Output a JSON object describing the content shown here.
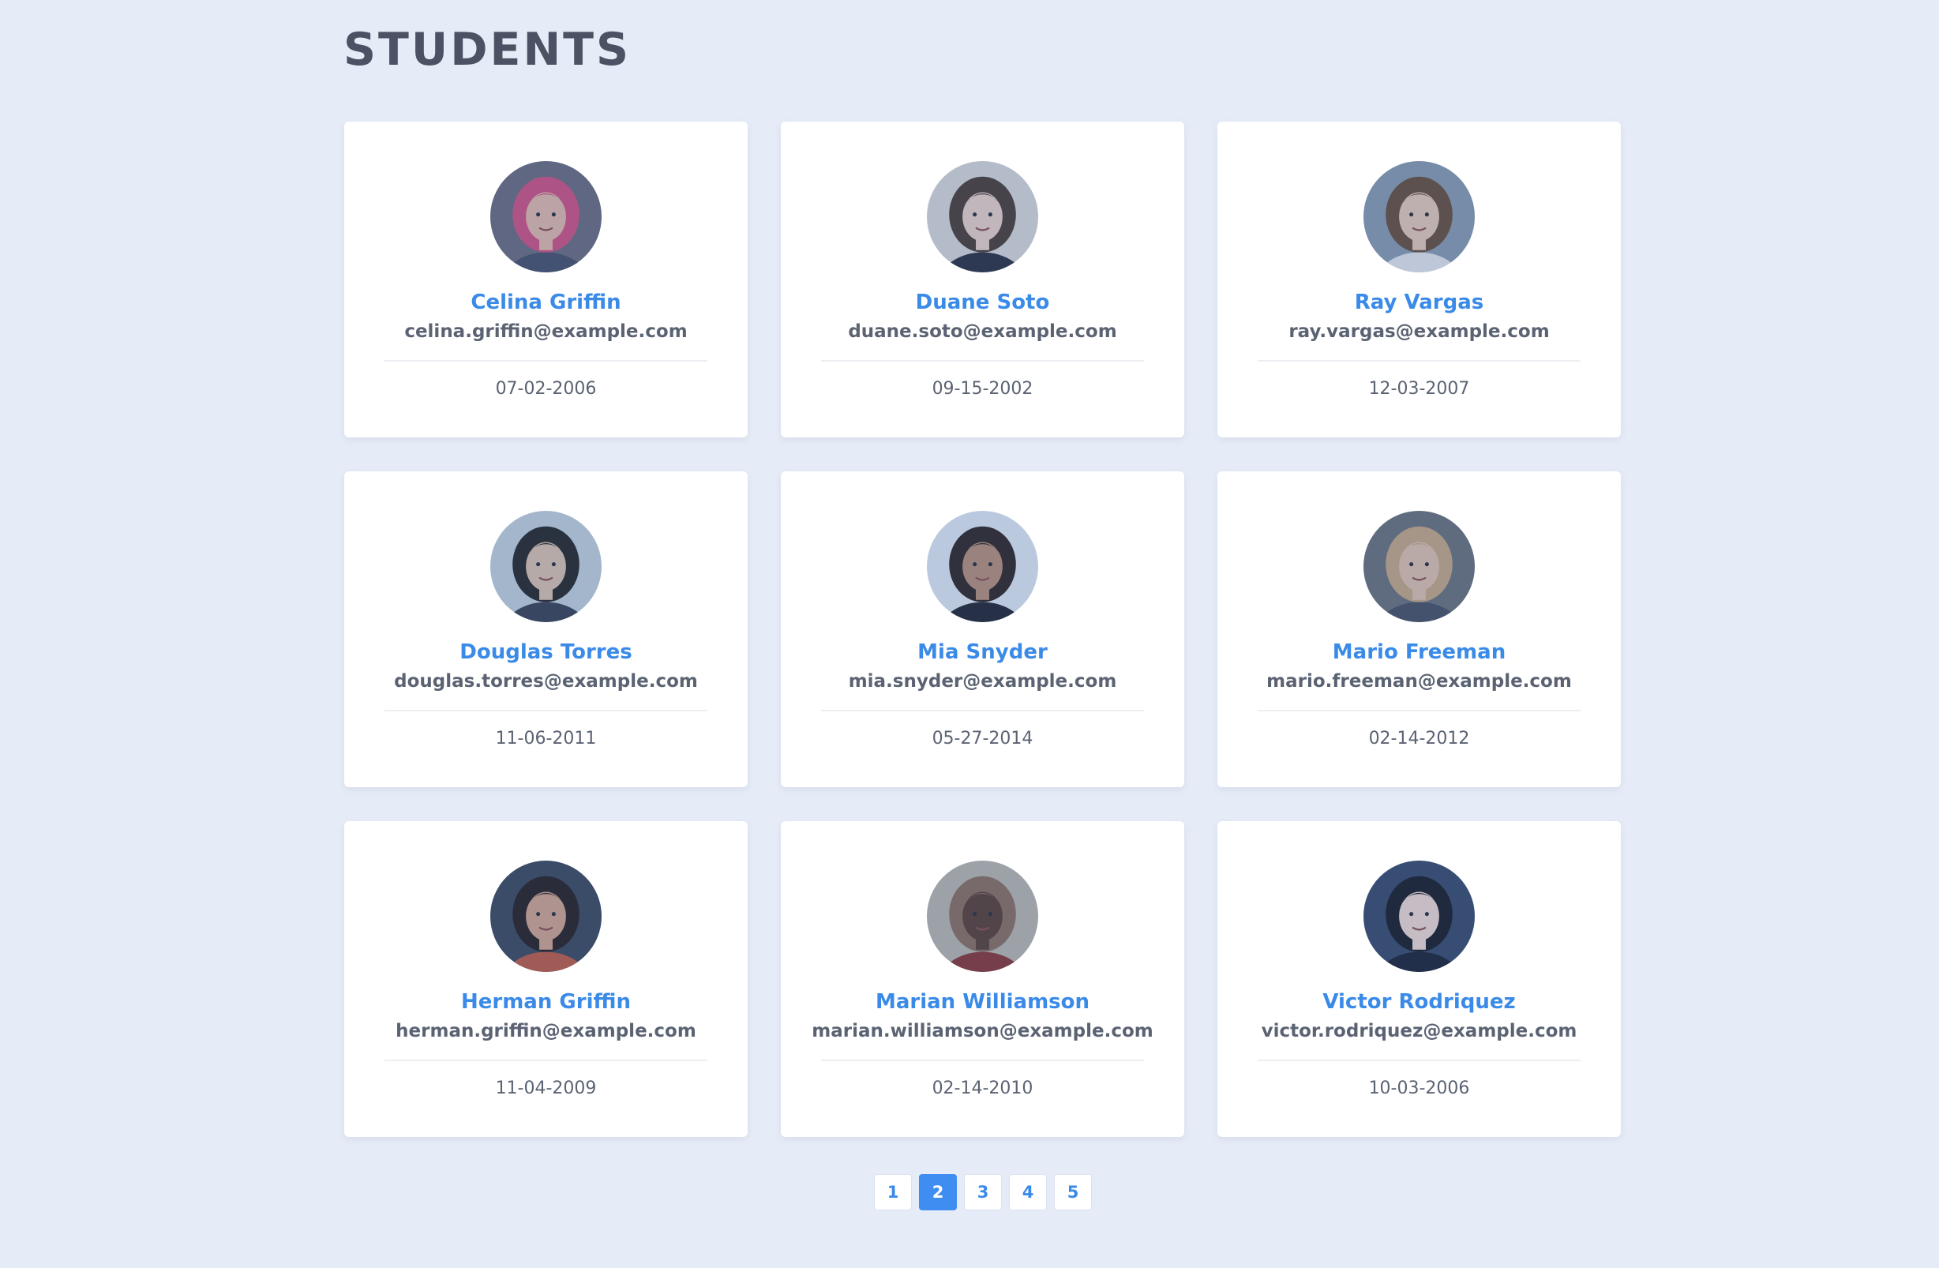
{
  "page": {
    "title": "STUDENTS"
  },
  "students": [
    {
      "name": "Celina Griffin",
      "email": "celina.griffin@example.com",
      "date": "07-02-2006",
      "avatar": {
        "bg": "#6f6a78",
        "hair": "#d2507c",
        "skin": "#e4b8a6",
        "shirt": "#4a4e63"
      }
    },
    {
      "name": "Duane Soto",
      "email": "duane.soto@example.com",
      "date": "09-15-2002",
      "avatar": {
        "bg": "#dcd6d2",
        "hair": "#4d3b31",
        "skin": "#e9cfc1",
        "shirt": "#2d2f3b"
      }
    },
    {
      "name": "Ray Vargas",
      "email": "ray.vargas@example.com",
      "date": "12-03-2007",
      "avatar": {
        "bg": "#8c99a8",
        "hair": "#6a4d37",
        "skin": "#e7c7b0",
        "shirt": "#e6e4e6"
      }
    },
    {
      "name": "Douglas Torres",
      "email": "douglas.torres@example.com",
      "date": "11-06-2011",
      "avatar": {
        "bg": "#c6cfd6",
        "hair": "#2a2522",
        "skin": "#dcbfa7",
        "shirt": "#3b3f4e"
      }
    },
    {
      "name": "Mia Snyder",
      "email": "mia.snyder@example.com",
      "date": "05-27-2014",
      "avatar": {
        "bg": "#e3e7ee",
        "hair": "#33241f",
        "skin": "#b98d73",
        "shirt": "#24252c"
      }
    },
    {
      "name": "Mario Freeman",
      "email": "mario.freeman@example.com",
      "date": "02-14-2012",
      "avatar": {
        "bg": "#6d6f74",
        "hair": "#c8a67e",
        "skin": "#e2bfa7",
        "shirt": "#4b4f5d"
      }
    },
    {
      "name": "Herman Griffin",
      "email": "herman.griffin@example.com",
      "date": "11-04-2009",
      "avatar": {
        "bg": "#3f4758",
        "hair": "#2b1e1b",
        "skin": "#d3a287",
        "shirt": "#c25a3f"
      }
    },
    {
      "name": "Marian Williamson",
      "email": "marian.williamson@example.com",
      "date": "02-14-2010",
      "avatar": {
        "bg": "#bdb5aa",
        "hair": "#8d6d59",
        "skin": "#5b3e2f",
        "shirt": "#8a3530"
      }
    },
    {
      "name": "Victor Rodriquez",
      "email": "victor.rodriquez@example.com",
      "date": "10-03-2006",
      "avatar": {
        "bg": "#3c4866",
        "hair": "#1c1c22",
        "skin": "#f0d8cb",
        "shirt": "#1f2230"
      }
    }
  ],
  "pagination": {
    "pages": [
      "1",
      "2",
      "3",
      "4",
      "5"
    ],
    "current": "2"
  },
  "colors": {
    "background": "#e6ecf7",
    "accent": "#3a8ae8",
    "text": "#5b6373",
    "title": "#4a5263"
  }
}
